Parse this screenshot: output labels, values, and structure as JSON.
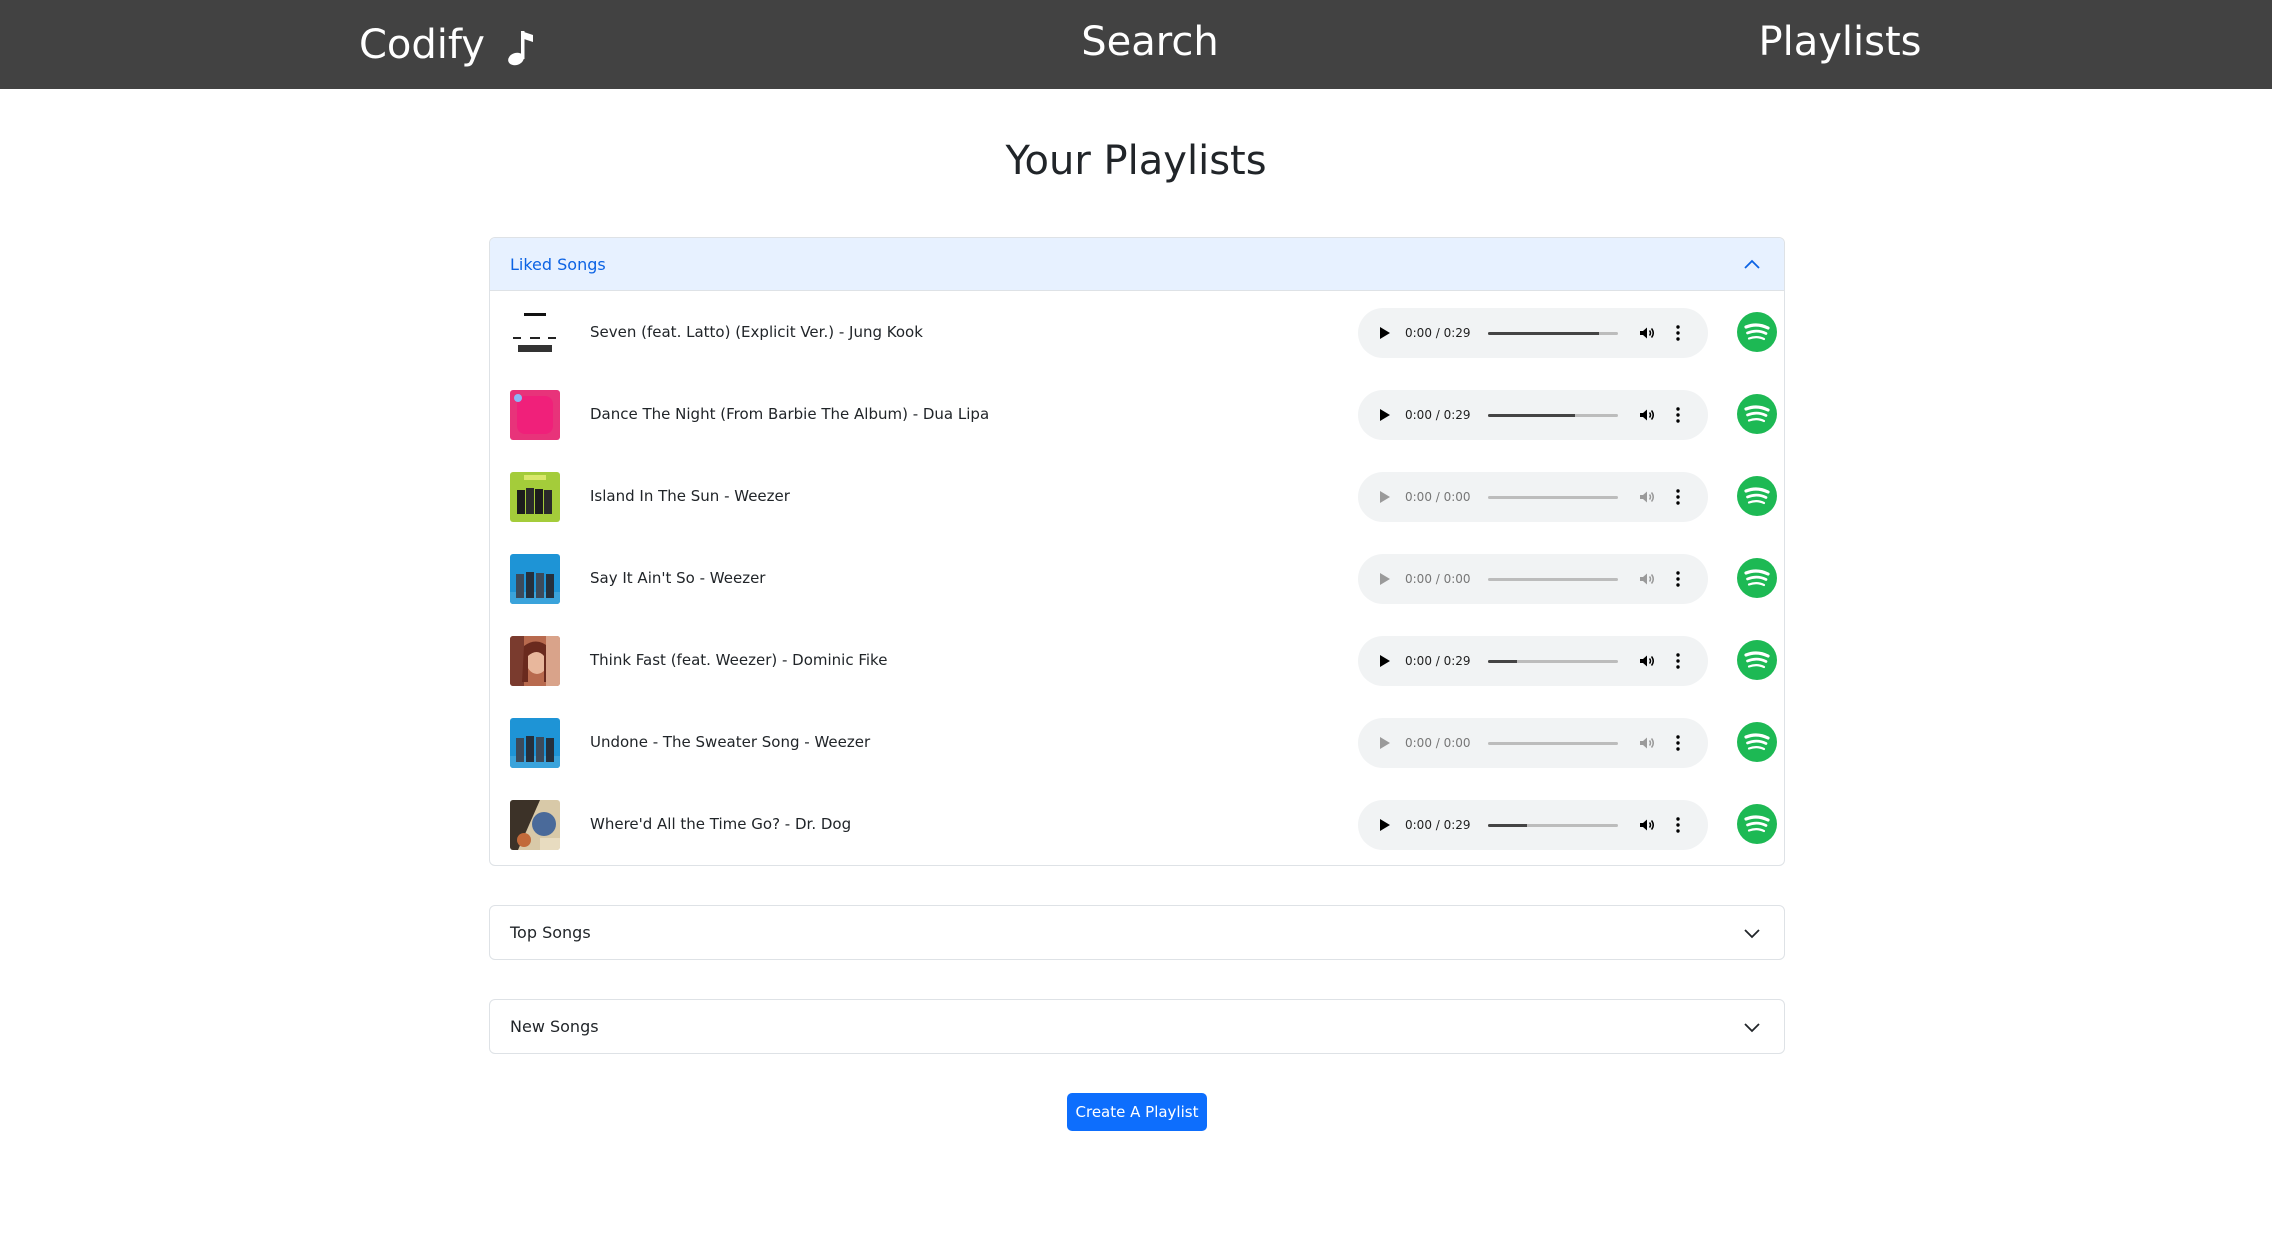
{
  "nav": {
    "brand": "Codify",
    "search": "Search",
    "playlists": "Playlists"
  },
  "page": {
    "title": "Your Playlists"
  },
  "playlists": [
    {
      "label": "Liked Songs",
      "expanded": true,
      "songs": [
        {
          "title": "Seven (feat. Latto) (Explicit Ver.) - Jung Kook",
          "time": "0:00 / 0:29",
          "progress": 0.85,
          "enabled": true
        },
        {
          "title": "Dance The Night (From Barbie The Album) - Dua Lipa",
          "time": "0:00 / 0:29",
          "progress": 0.67,
          "enabled": true
        },
        {
          "title": "Island In The Sun - Weezer",
          "time": "0:00 / 0:00",
          "progress": 0,
          "enabled": false
        },
        {
          "title": "Say It Ain't So - Weezer",
          "time": "0:00 / 0:00",
          "progress": 0,
          "enabled": false
        },
        {
          "title": "Think Fast (feat. Weezer) - Dominic Fike",
          "time": "0:00 / 0:29",
          "progress": 0.22,
          "enabled": true
        },
        {
          "title": "Undone - The Sweater Song - Weezer",
          "time": "0:00 / 0:00",
          "progress": 0,
          "enabled": false
        },
        {
          "title": "Where'd All the Time Go? - Dr. Dog",
          "time": "0:00 / 0:29",
          "progress": 0.3,
          "enabled": true
        }
      ]
    },
    {
      "label": "Top Songs",
      "expanded": false
    },
    {
      "label": "New Songs",
      "expanded": false
    }
  ],
  "actions": {
    "create_playlist": "Create A Playlist"
  },
  "colors": {
    "navbar": "#424242",
    "primary": "#0d6efd",
    "accordion_active_bg": "#e7f1ff",
    "spotify_green": "#1db954"
  }
}
